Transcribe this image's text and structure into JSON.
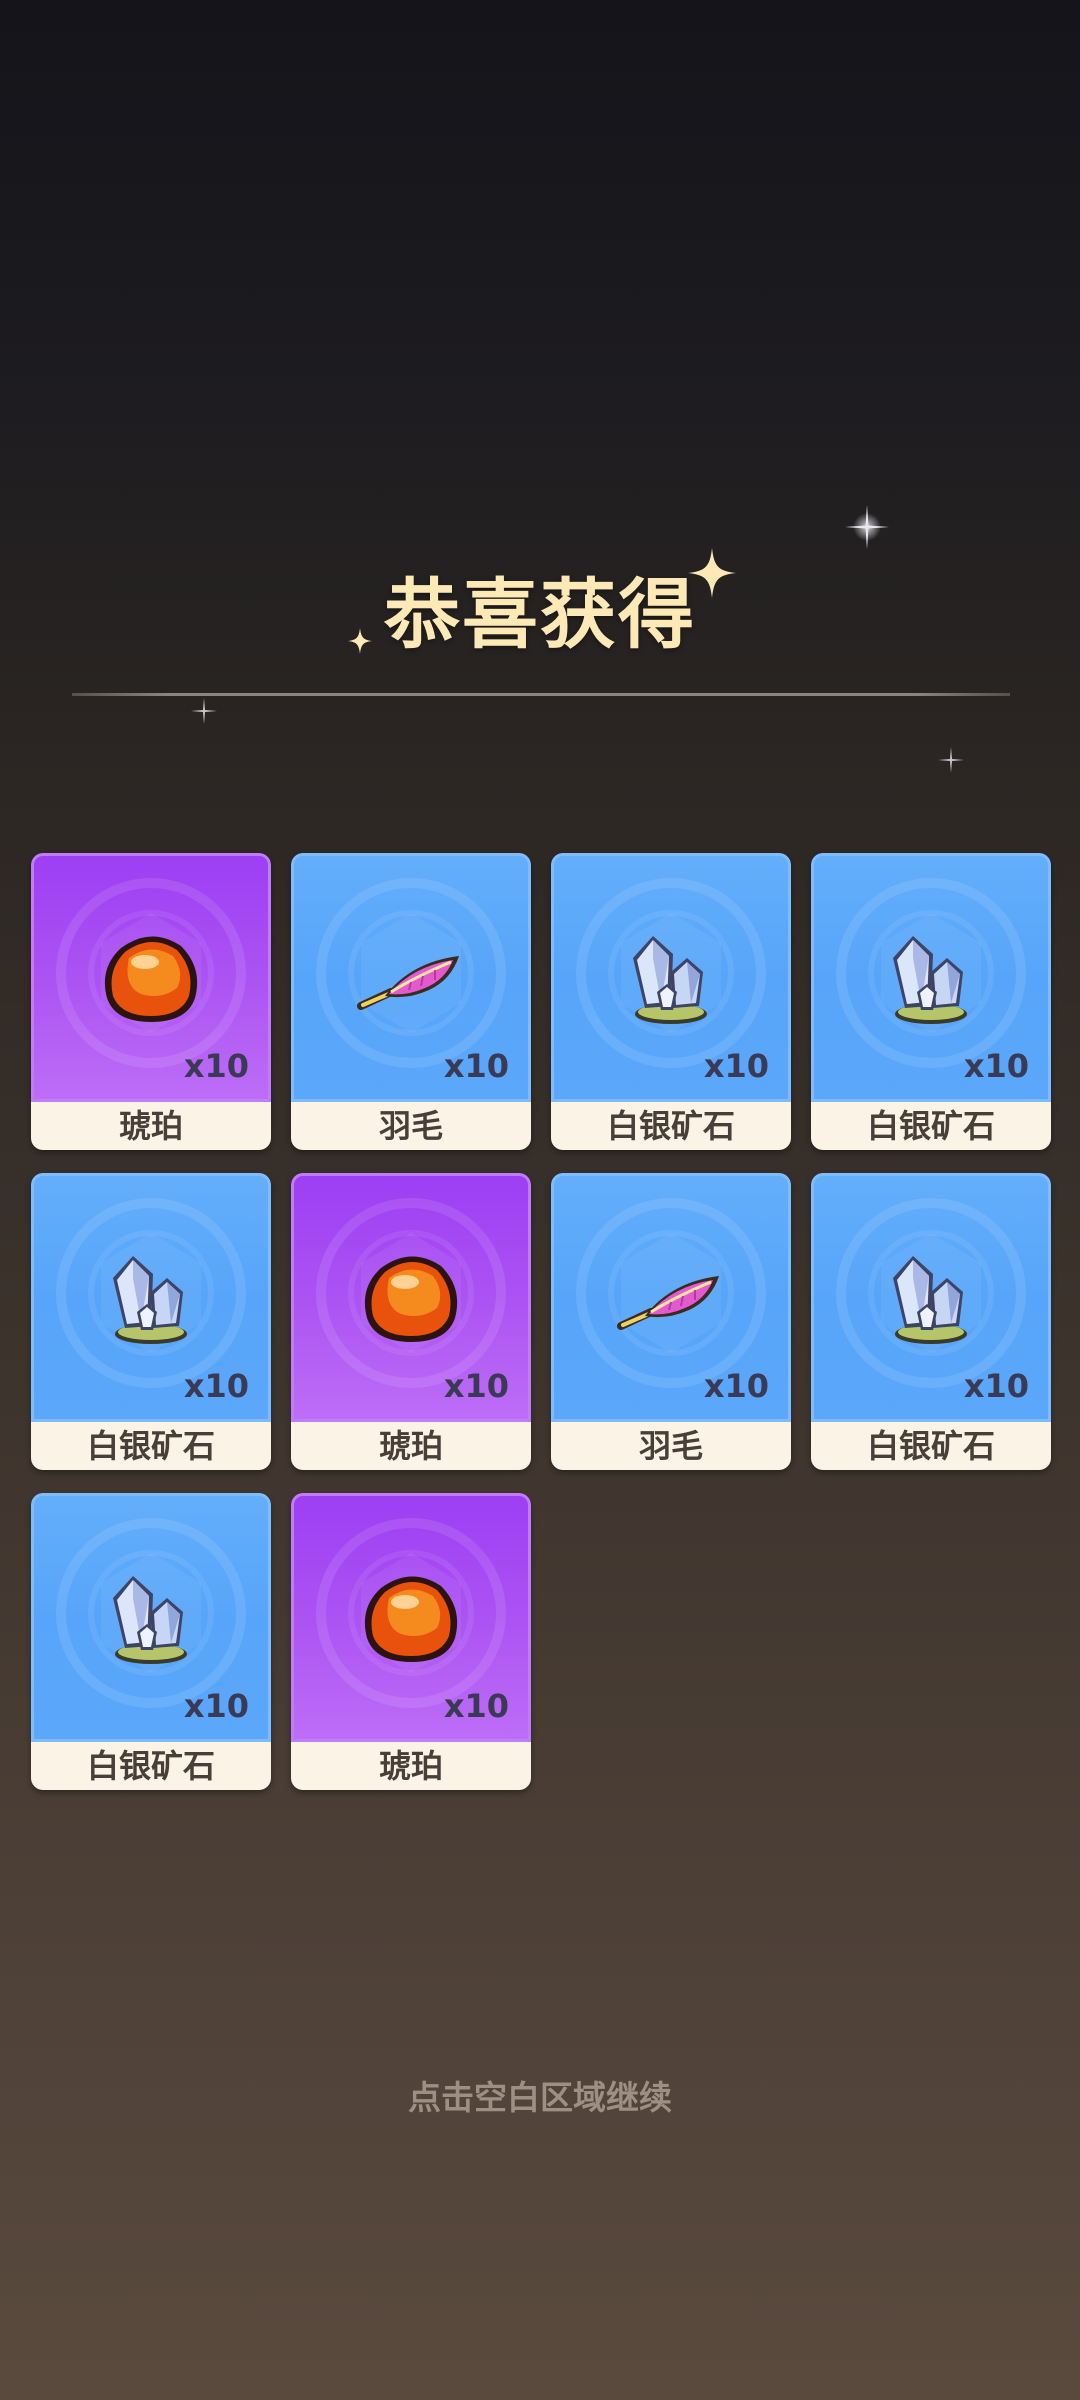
{
  "title": "恭喜获得",
  "items": [
    {
      "name": "琥珀",
      "qty": "x10",
      "rarity": "purple",
      "icon": "amber-icon"
    },
    {
      "name": "羽毛",
      "qty": "x10",
      "rarity": "blue",
      "icon": "feather-icon"
    },
    {
      "name": "白银矿石",
      "qty": "x10",
      "rarity": "blue",
      "icon": "silver-ore-icon"
    },
    {
      "name": "白银矿石",
      "qty": "x10",
      "rarity": "blue",
      "icon": "silver-ore-icon"
    },
    {
      "name": "白银矿石",
      "qty": "x10",
      "rarity": "blue",
      "icon": "silver-ore-icon"
    },
    {
      "name": "琥珀",
      "qty": "x10",
      "rarity": "purple",
      "icon": "amber-icon"
    },
    {
      "name": "羽毛",
      "qty": "x10",
      "rarity": "blue",
      "icon": "feather-icon"
    },
    {
      "name": "白银矿石",
      "qty": "x10",
      "rarity": "blue",
      "icon": "silver-ore-icon"
    },
    {
      "name": "白银矿石",
      "qty": "x10",
      "rarity": "blue",
      "icon": "silver-ore-icon"
    },
    {
      "name": "琥珀",
      "qty": "x10",
      "rarity": "purple",
      "icon": "amber-icon"
    }
  ],
  "footer_hint": "点击空白区域继续",
  "colors": {
    "title": "#fde9b6",
    "rarity_blue": "#57a5fa",
    "rarity_purple": "#ad55f3",
    "label_bg": "#fbf3e6",
    "label_text": "#4a3f38",
    "hint_text": "#9d8f83"
  }
}
